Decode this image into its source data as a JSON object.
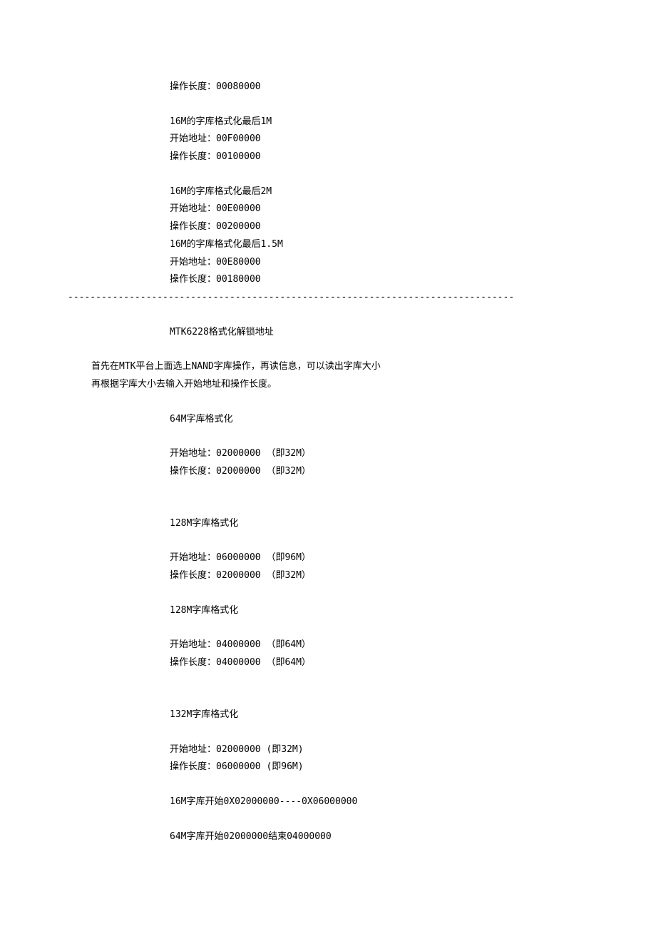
{
  "section1": {
    "line0": "操作长度：00080000",
    "block1_title": "16M的字库格式化最后1M",
    "block1_addr": "开始地址：00F00000",
    "block1_len": "操作长度：00100000",
    "block2_title": "16M的字库格式化最后2M",
    "block2_addr": "开始地址：00E00000",
    "block2_len": "操作长度：00200000",
    "block3_title": "16M的字库格式化最后1.5M",
    "block3_addr": "开始地址：00E80000",
    "block3_len": "操作长度：00180000"
  },
  "separator": "--------------------------------------------------------------------------------",
  "section2": {
    "heading": "MTK6228格式化解锁地址",
    "intro1": "首先在MTK平台上面选上NAND字库操作，再读信息，可以读出字库大小",
    "intro2": "再根据字库大小去输入开始地址和操作长度。",
    "b64_title": "64M字库格式化",
    "b64_addr": "开始地址：02000000   （即32M）",
    "b64_len": "操作长度：02000000   （即32M）",
    "b128a_title": "128M字库格式化",
    "b128a_addr": "开始地址：06000000   （即96M）",
    "b128a_len": "操作长度：02000000   （即32M）",
    "b128b_title": "128M字库格式化",
    "b128b_addr": "开始地址：04000000   （即64M）",
    "b128b_len": "操作长度：04000000   （即64M）",
    "b132_title": "132M字库格式化",
    "b132_addr": "开始地址：02000000    (即32M)",
    "b132_len": "操作长度：06000000    (即96M)",
    "range16": "16M字库开始0X02000000----0X06000000",
    "range64": "64M字库开始02000000结束04000000"
  }
}
